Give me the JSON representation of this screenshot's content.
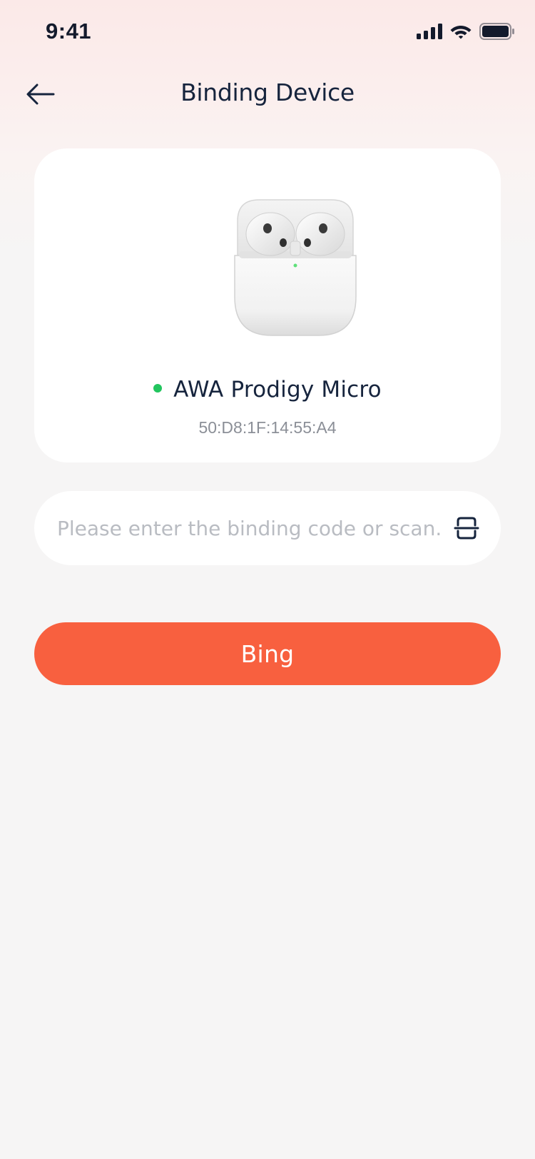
{
  "status_bar": {
    "time": "9:41",
    "icons": [
      "cellular-signal-icon",
      "wifi-icon",
      "battery-icon"
    ]
  },
  "nav": {
    "title": "Binding Device",
    "back_icon": "arrow-left-icon"
  },
  "device": {
    "name": "AWA Prodigy Micro",
    "mac": "50:D8:1F:14:55:A4",
    "status": "connected",
    "status_color": "#22c55e",
    "image_icon": "earbuds-case-image"
  },
  "binding_input": {
    "value": "",
    "placeholder": "Please enter the binding code or scan...",
    "scan_icon": "scan-icon"
  },
  "bind_button": {
    "label": "Bing",
    "color": "#f8603f"
  }
}
